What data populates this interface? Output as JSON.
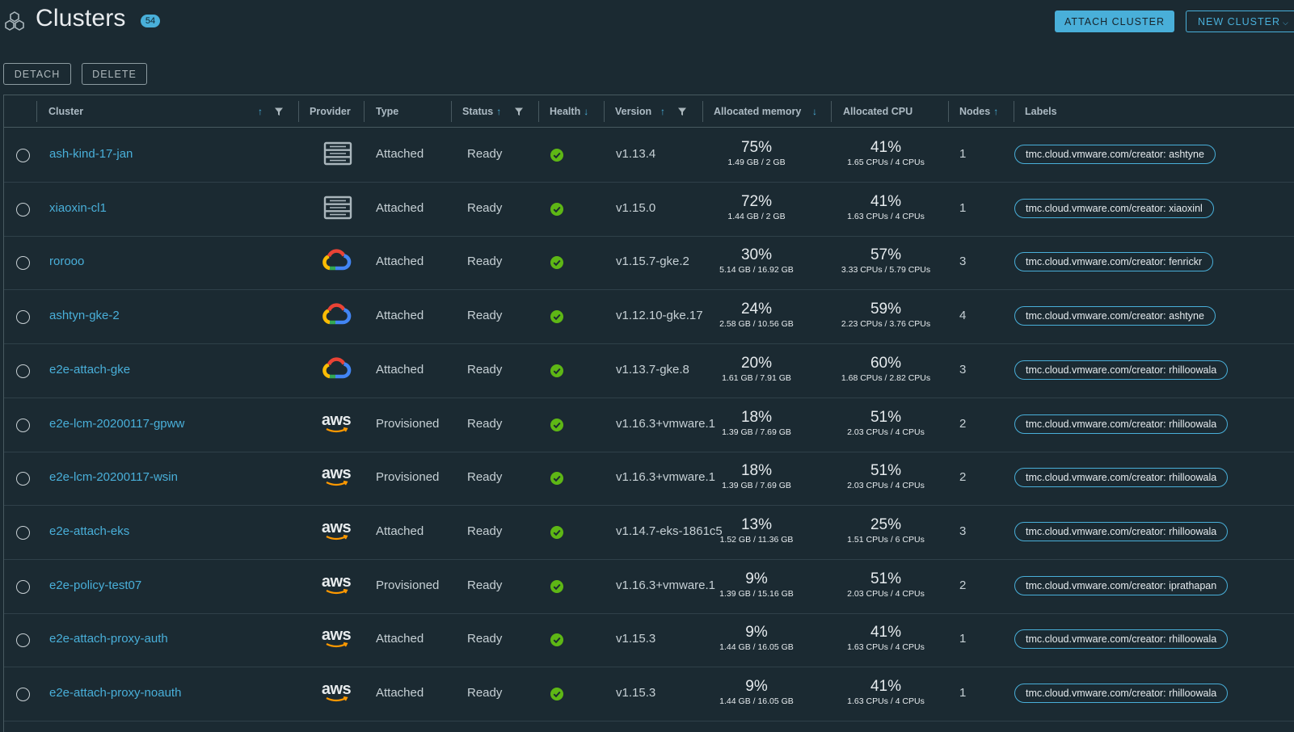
{
  "header": {
    "title": "Clusters",
    "count": "54",
    "attach_label": "ATTACH CLUSTER",
    "new_label": "NEW CLUSTER"
  },
  "toolbar": {
    "detach_label": "DETACH",
    "delete_label": "DELETE"
  },
  "columns": {
    "cluster": "Cluster",
    "provider": "Provider",
    "type": "Type",
    "status": "Status",
    "health": "Health",
    "version": "Version",
    "memory": "Allocated memory",
    "cpu": "Allocated CPU",
    "nodes": "Nodes",
    "labels": "Labels"
  },
  "rows": [
    {
      "name": "ash-kind-17-jan",
      "provider": "server",
      "type": "Attached",
      "status": "Ready",
      "version": "v1.13.4",
      "mem_pct": "75%",
      "mem_detail": "1.49 GB / 2 GB",
      "cpu_pct": "41%",
      "cpu_detail": "1.65 CPUs / 4 CPUs",
      "nodes": "1",
      "label": "tmc.cloud.vmware.com/creator: ashtyne"
    },
    {
      "name": "xiaoxin-cl1",
      "provider": "server",
      "type": "Attached",
      "status": "Ready",
      "version": "v1.15.0",
      "mem_pct": "72%",
      "mem_detail": "1.44 GB / 2 GB",
      "cpu_pct": "41%",
      "cpu_detail": "1.63 CPUs / 4 CPUs",
      "nodes": "1",
      "label": "tmc.cloud.vmware.com/creator: xiaoxinl"
    },
    {
      "name": "rorooo",
      "provider": "gcp",
      "type": "Attached",
      "status": "Ready",
      "version": "v1.15.7-gke.2",
      "mem_pct": "30%",
      "mem_detail": "5.14 GB / 16.92 GB",
      "cpu_pct": "57%",
      "cpu_detail": "3.33 CPUs / 5.79 CPUs",
      "nodes": "3",
      "label": "tmc.cloud.vmware.com/creator: fenrickr"
    },
    {
      "name": "ashtyn-gke-2",
      "provider": "gcp",
      "type": "Attached",
      "status": "Ready",
      "version": "v1.12.10-gke.17",
      "mem_pct": "24%",
      "mem_detail": "2.58 GB / 10.56 GB",
      "cpu_pct": "59%",
      "cpu_detail": "2.23 CPUs / 3.76 CPUs",
      "nodes": "4",
      "label": "tmc.cloud.vmware.com/creator: ashtyne"
    },
    {
      "name": "e2e-attach-gke",
      "provider": "gcp",
      "type": "Attached",
      "status": "Ready",
      "version": "v1.13.7-gke.8",
      "mem_pct": "20%",
      "mem_detail": "1.61 GB / 7.91 GB",
      "cpu_pct": "60%",
      "cpu_detail": "1.68 CPUs / 2.82 CPUs",
      "nodes": "3",
      "label": "tmc.cloud.vmware.com/creator: rhilloowala"
    },
    {
      "name": "e2e-lcm-20200117-gpww",
      "provider": "aws",
      "type": "Provisioned",
      "status": "Ready",
      "version": "v1.16.3+vmware.1",
      "mem_pct": "18%",
      "mem_detail": "1.39 GB / 7.69 GB",
      "cpu_pct": "51%",
      "cpu_detail": "2.03 CPUs / 4 CPUs",
      "nodes": "2",
      "label": "tmc.cloud.vmware.com/creator: rhilloowala"
    },
    {
      "name": "e2e-lcm-20200117-wsin",
      "provider": "aws",
      "type": "Provisioned",
      "status": "Ready",
      "version": "v1.16.3+vmware.1",
      "mem_pct": "18%",
      "mem_detail": "1.39 GB / 7.69 GB",
      "cpu_pct": "51%",
      "cpu_detail": "2.03 CPUs / 4 CPUs",
      "nodes": "2",
      "label": "tmc.cloud.vmware.com/creator: rhilloowala"
    },
    {
      "name": "e2e-attach-eks",
      "provider": "aws",
      "type": "Attached",
      "status": "Ready",
      "version": "v1.14.7-eks-1861c5",
      "mem_pct": "13%",
      "mem_detail": "1.52 GB / 11.36 GB",
      "cpu_pct": "25%",
      "cpu_detail": "1.51 CPUs / 6 CPUs",
      "nodes": "3",
      "label": "tmc.cloud.vmware.com/creator: rhilloowala"
    },
    {
      "name": "e2e-policy-test07",
      "provider": "aws",
      "type": "Provisioned",
      "status": "Ready",
      "version": "v1.16.3+vmware.1",
      "mem_pct": "9%",
      "mem_detail": "1.39 GB / 15.16 GB",
      "cpu_pct": "51%",
      "cpu_detail": "2.03 CPUs / 4 CPUs",
      "nodes": "2",
      "label": "tmc.cloud.vmware.com/creator: iprathapan"
    },
    {
      "name": "e2e-attach-proxy-auth",
      "provider": "aws",
      "type": "Attached",
      "status": "Ready",
      "version": "v1.15.3",
      "mem_pct": "9%",
      "mem_detail": "1.44 GB / 16.05 GB",
      "cpu_pct": "41%",
      "cpu_detail": "1.63 CPUs / 4 CPUs",
      "nodes": "1",
      "label": "tmc.cloud.vmware.com/creator: rhilloowala"
    },
    {
      "name": "e2e-attach-proxy-noauth",
      "provider": "aws",
      "type": "Attached",
      "status": "Ready",
      "version": "v1.15.3",
      "mem_pct": "9%",
      "mem_detail": "1.44 GB / 16.05 GB",
      "cpu_pct": "41%",
      "cpu_detail": "1.63 CPUs / 4 CPUs",
      "nodes": "1",
      "label": "tmc.cloud.vmware.com/creator: rhilloowala"
    }
  ],
  "colors": {
    "background": "#1b2a32",
    "accent": "#49afd9",
    "healthy": "#5eb715"
  }
}
